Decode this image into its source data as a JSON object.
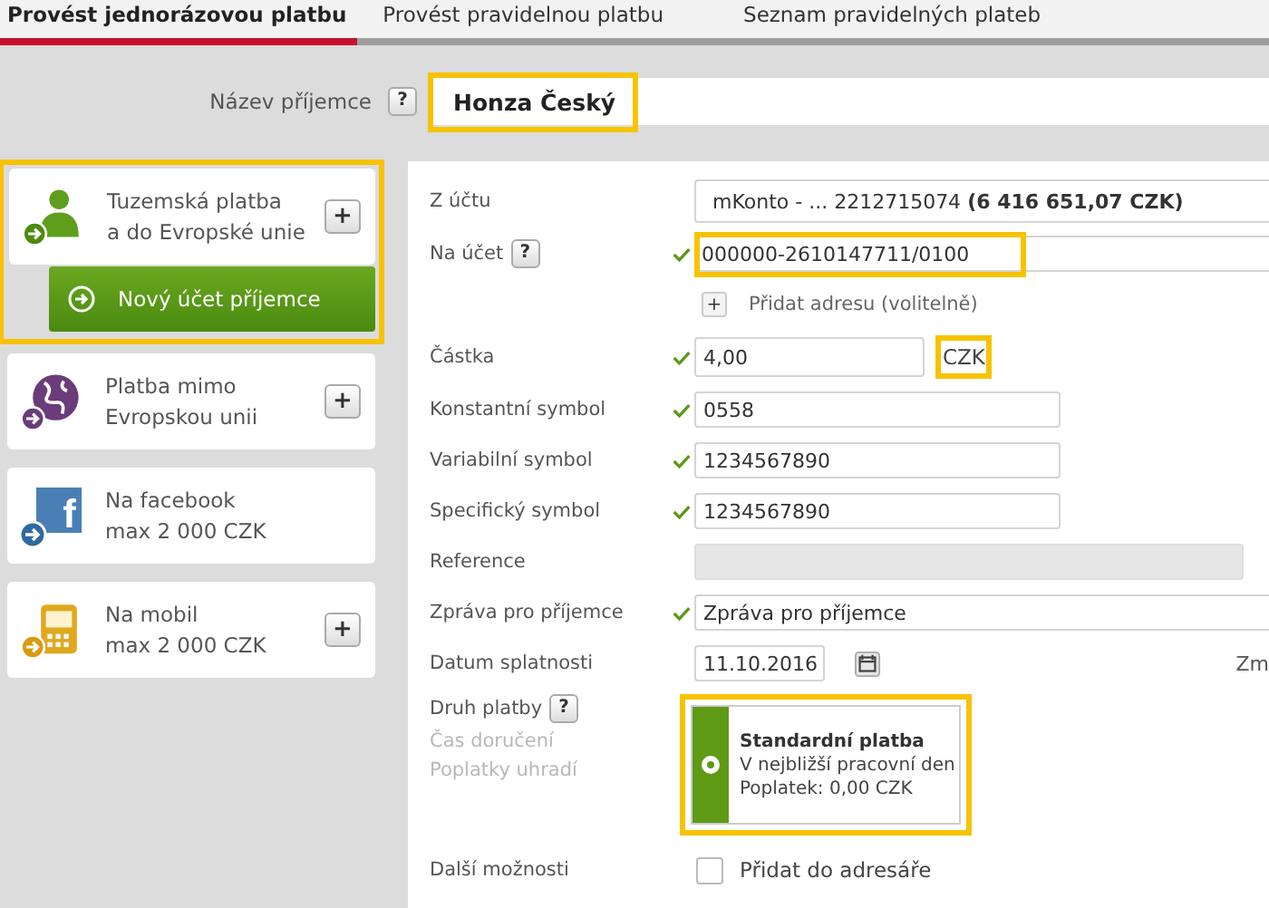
{
  "tabs": [
    {
      "label": "Provést jednorázovou platbu",
      "selected": true
    },
    {
      "label": "Provést pravidelnou platbu",
      "selected": false
    },
    {
      "label": "Seznam pravidelných plateb",
      "selected": false
    }
  ],
  "recipient": {
    "label": "Název příjemce",
    "help": "?",
    "value": "Honza Český",
    "highlighted": true
  },
  "payment_types": [
    {
      "kind": "person",
      "title": "Tuzemská platba",
      "subtitle": "a do Evropské unie",
      "add": "+",
      "action": "Nový účet příjemce",
      "highlighted": true
    },
    {
      "kind": "globe",
      "title": "Platba mimo",
      "subtitle": "Evropskou unii",
      "add": "+",
      "highlighted": false
    },
    {
      "kind": "square",
      "icon_text": "f",
      "title": "Na facebook",
      "subtitle": "max 2 000 CZK",
      "highlighted": false
    },
    {
      "kind": "phone",
      "title": "Na mobil",
      "subtitle": "max 2 000 CZK",
      "add": "+",
      "highlighted": false
    }
  ],
  "form": [
    {
      "kind": "select",
      "label": "Z účtu",
      "value": "mKonto - ... 2212715074 **(6 416 651,07 CZK)**",
      "valid": false
    },
    {
      "kind": "input",
      "label": "Na účet",
      "help": "?",
      "value": "000000-2610147711/0100",
      "valid": true,
      "wide": true,
      "highlighted": true
    },
    {
      "kind": "link",
      "add": "+",
      "text": "Přidat adresu (volitelně)"
    },
    {
      "kind": "amount",
      "label": "Částka",
      "value": "4,00",
      "currency": "CZK",
      "valid": true,
      "highlighted": true
    },
    {
      "kind": "input",
      "label": "Konstantní symbol",
      "value": "0558",
      "valid": true,
      "wide": false,
      "highlighted": false
    },
    {
      "kind": "input",
      "label": "Variabilní symbol",
      "value": "1234567890",
      "valid": true,
      "wide": false,
      "highlighted": false
    },
    {
      "kind": "input",
      "label": "Specifický symbol",
      "value": "1234567890",
      "valid": true,
      "wide": false,
      "highlighted": false
    },
    {
      "kind": "readonly",
      "label": "Reference",
      "valid": false
    },
    {
      "kind": "input",
      "label": "Zpráva pro příjemce",
      "value": "Zpráva pro příjemce",
      "valid": true,
      "wide": true,
      "highlighted": false
    },
    {
      "kind": "date",
      "label": "Datum splatnosti",
      "value": "11.10.2016",
      "aside": "Zm",
      "valid": false
    },
    {
      "kind": "option",
      "label": "Druh platby",
      "help": "?",
      "sublabels": [
        "Čas doručení",
        "Poplatky uhradí"
      ],
      "title": "Standardní platba",
      "lines": [
        "V nejbližší pracovní den",
        "Poplatek: 0,00 CZK"
      ],
      "selected": true,
      "highlighted": true
    },
    {
      "kind": "checkbox",
      "label": "Další možnosti",
      "text": "Přidat do adresáře",
      "checked": false
    }
  ]
}
